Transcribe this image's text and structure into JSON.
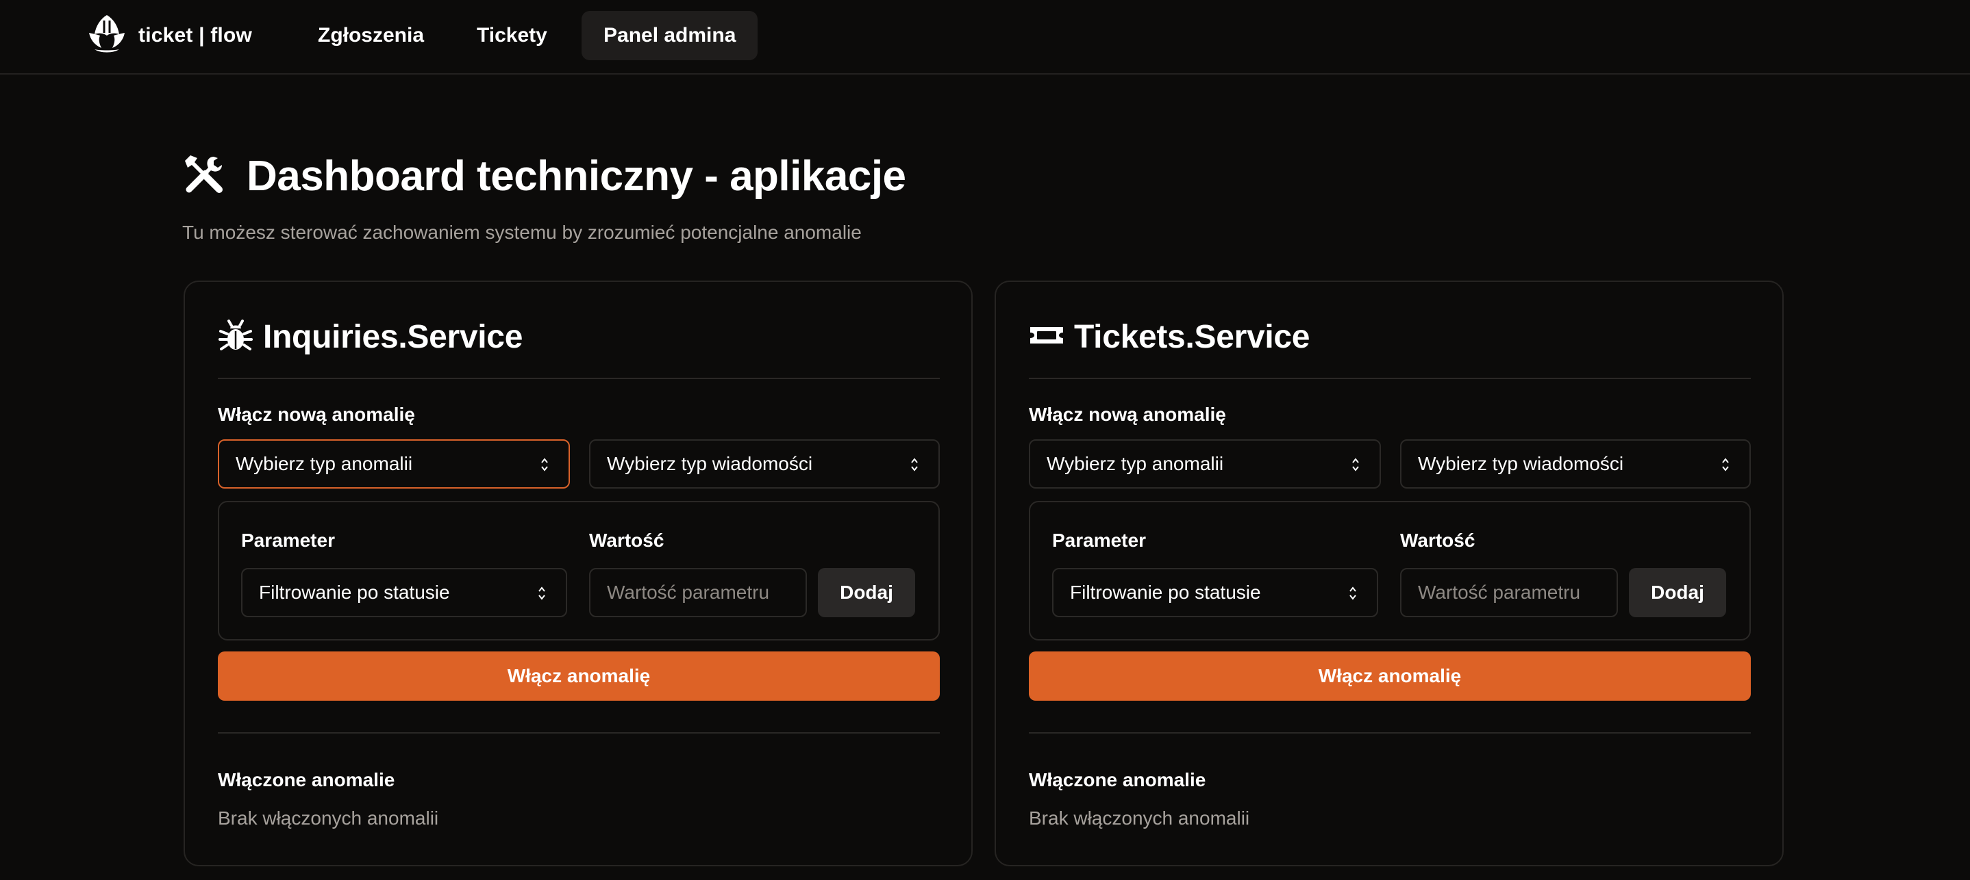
{
  "brand": {
    "name": "ticket | flow",
    "icon": "app-logo-icon"
  },
  "nav": {
    "items": [
      {
        "label": "Zgłoszenia",
        "active": false
      },
      {
        "label": "Tickety",
        "active": false
      },
      {
        "label": "Panel admina",
        "active": true
      }
    ]
  },
  "header": {
    "icon": "tools-icon",
    "title": "Dashboard techniczny - aplikacje",
    "subtitle": "Tu możesz sterować zachowaniem systemu by zrozumieć potencjalne anomalie"
  },
  "cards": [
    {
      "icon": "bug-icon",
      "title": "Inquiries.Service",
      "enable_label": "Włącz nową anomalię",
      "anomaly_type_select": "Wybierz typ anomalii",
      "message_type_select": "Wybierz typ wiadomości",
      "parameter_label": "Parameter",
      "parameter_select": "Filtrowanie po statusie",
      "value_label": "Wartość",
      "value_placeholder": "Wartość parametru",
      "add_button": "Dodaj",
      "enable_button": "Włącz anomalię",
      "enabled_label": "Włączone anomalie",
      "empty_text": "Brak włączonych anomalii"
    },
    {
      "icon": "ticket-icon",
      "title": "Tickets.Service",
      "enable_label": "Włącz nową anomalię",
      "anomaly_type_select": "Wybierz typ anomalii",
      "message_type_select": "Wybierz typ wiadomości",
      "parameter_label": "Parameter",
      "parameter_select": "Filtrowanie po statusie",
      "value_label": "Wartość",
      "value_placeholder": "Wartość parametru",
      "add_button": "Dodaj",
      "enable_button": "Włącz anomalię",
      "enabled_label": "Włączone anomalie",
      "empty_text": "Brak włączonych anomalii"
    }
  ],
  "colors": {
    "background": "#0c0b0a",
    "accent": "#dd6226",
    "border": "#2b2927",
    "muted_text": "#a7a29d"
  }
}
